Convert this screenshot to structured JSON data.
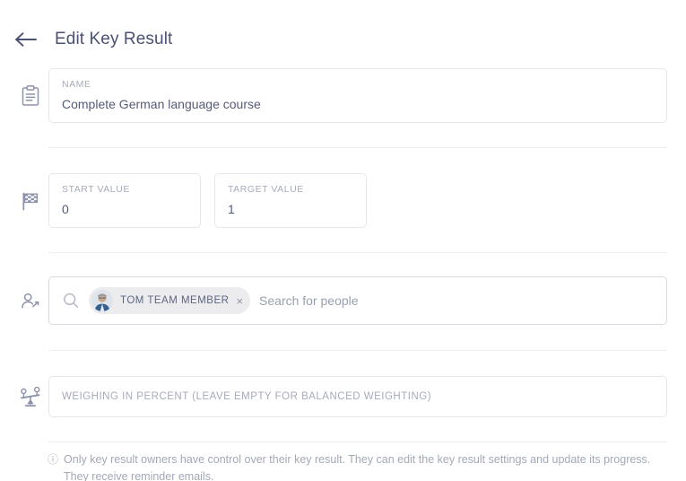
{
  "header": {
    "back_icon": "arrow-left-icon",
    "title": "Edit Key Result"
  },
  "name_section": {
    "icon": "clipboard-icon",
    "label": "NAME",
    "value": "Complete German language course"
  },
  "values_section": {
    "icon": "checkered-flag-icon",
    "start": {
      "label": "START VALUE",
      "value": "0"
    },
    "target": {
      "label": "TARGET VALUE",
      "value": "1"
    }
  },
  "people_section": {
    "icon": "person-add-icon",
    "search_icon": "search-icon",
    "placeholder": "Search for people",
    "chips": [
      {
        "name": "TOM TEAM MEMBER",
        "avatar": "user-photo-avatar",
        "remove_icon": "close-icon",
        "remove_label": "×"
      }
    ]
  },
  "weighing_section": {
    "icon": "balance-scale-icon",
    "placeholder": "WEIGHING IN PERCENT (LEAVE EMPTY FOR BALANCED WEIGHTING)",
    "value": ""
  },
  "footer": {
    "info_icon": "info-circle-icon",
    "info_glyph": "ⓘ",
    "note": "Only key result owners have control over their key result. They can edit the key result settings and update its progress. They receive reminder emails."
  },
  "colors": {
    "title": "#4a5173",
    "label": "#a7abba",
    "value": "#545b77",
    "border": "#e6e7ea",
    "border_focus": "#d8dae1",
    "chip_bg": "#ececef",
    "divider": "#eceef1",
    "note": "#a3a8b6"
  }
}
